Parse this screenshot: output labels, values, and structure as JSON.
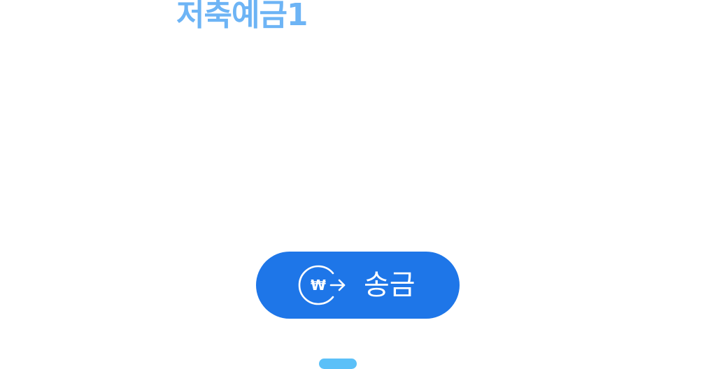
{
  "account": {
    "title": "저축예금1"
  },
  "transfer_button": {
    "label": "송금",
    "icon": "won-transfer-icon",
    "icon_symbol": "₩"
  },
  "page_indicator": {
    "active_page": 1
  },
  "colors": {
    "title": "#6db4f5",
    "button_background": "#1e76e8",
    "button_text": "#ffffff",
    "indicator": "#5bc0f8"
  }
}
